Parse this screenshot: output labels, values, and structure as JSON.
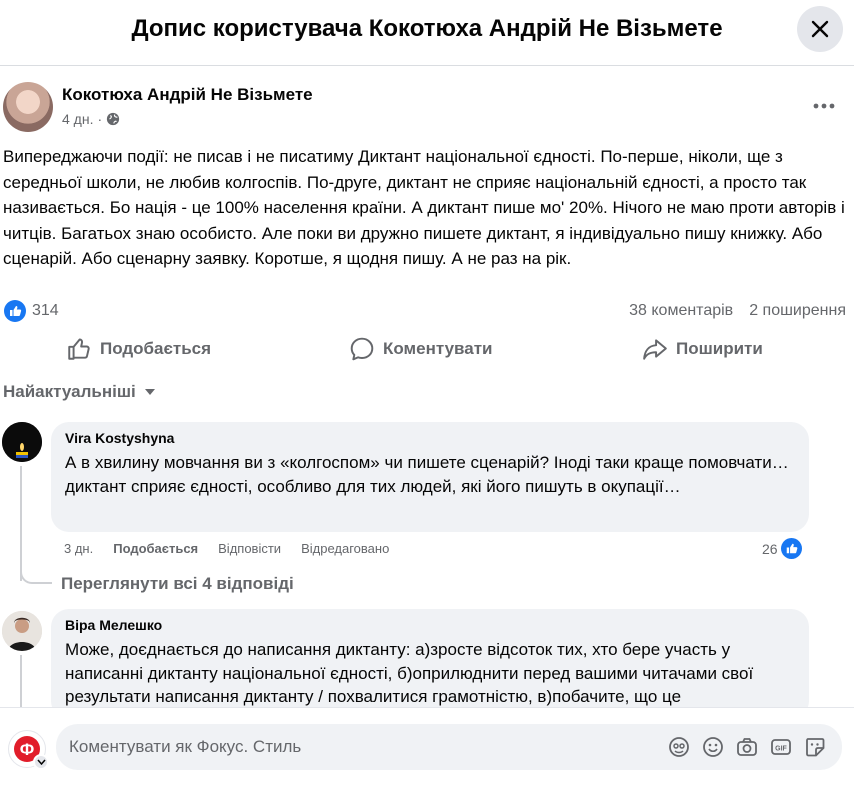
{
  "header": {
    "title": "Допис користувача Кокотюха Андрій Не Візьмете",
    "close_icon": "close-icon"
  },
  "post": {
    "author": "Кокотюха Андрій Не Візьмете",
    "time": "4 дн.",
    "privacy_icon": "globe-icon",
    "text": "Випереджаючи події: не писав і не писатиму Диктант національної єдності. По-перше, ніколи, ще з середньої школи, не любив колгоспів. По-друге, диктант не сприяє національній єдності, а просто так називається. Бо нація - це 100% населення країни. А диктант пише мо' 20%. Нічого не маю проти авторів і читців. Багатьох знаю особисто. Але поки ви дружно пишете диктант, я індивідуально пишу книжку. Або сценарій. Або сценарну заявку. Коротше, я щодня пишу. А не раз на рік.",
    "reactions_count": "314",
    "comments_count": "38 коментарів",
    "shares_count": "2 поширення"
  },
  "actions": {
    "like": "Подобається",
    "comment": "Коментувати",
    "share": "Поширити"
  },
  "sort": {
    "label": "Найактуальніші"
  },
  "comments": [
    {
      "author": "Vira Kostyshyna",
      "text": "А в хвилину мовчання ви з «колгоспом» чи пишете сценарій? Іноді таки краще помовчати… диктант сприяє єдності, особливо для тих людей, які його пишуть в окупації…",
      "time": "3 дн.",
      "like": "Подобається",
      "reply": "Відповісти",
      "edited": "Відредаговано",
      "likes": "26"
    },
    {
      "author": "Віра Мелешко",
      "text": "Може, доєднається до написання диктанту: а)зросте відсоток тих, хто бере участь у написанні диктанту національної єдності, б)оприлюднити перед вашими читачами свої результати написання диктанту / похвалитися грамотністю, в)побачите, що це"
    }
  ],
  "view_replies": "Переглянути всі 4 відповіді",
  "composer": {
    "placeholder": "Коментувати як Фокус. Стиль",
    "avatar_letter": "Ф"
  },
  "colors": {
    "accent": "#1877f2",
    "secondary_text": "#65676b",
    "bubble": "#f0f2f5",
    "brand_red": "#e11d2a"
  }
}
